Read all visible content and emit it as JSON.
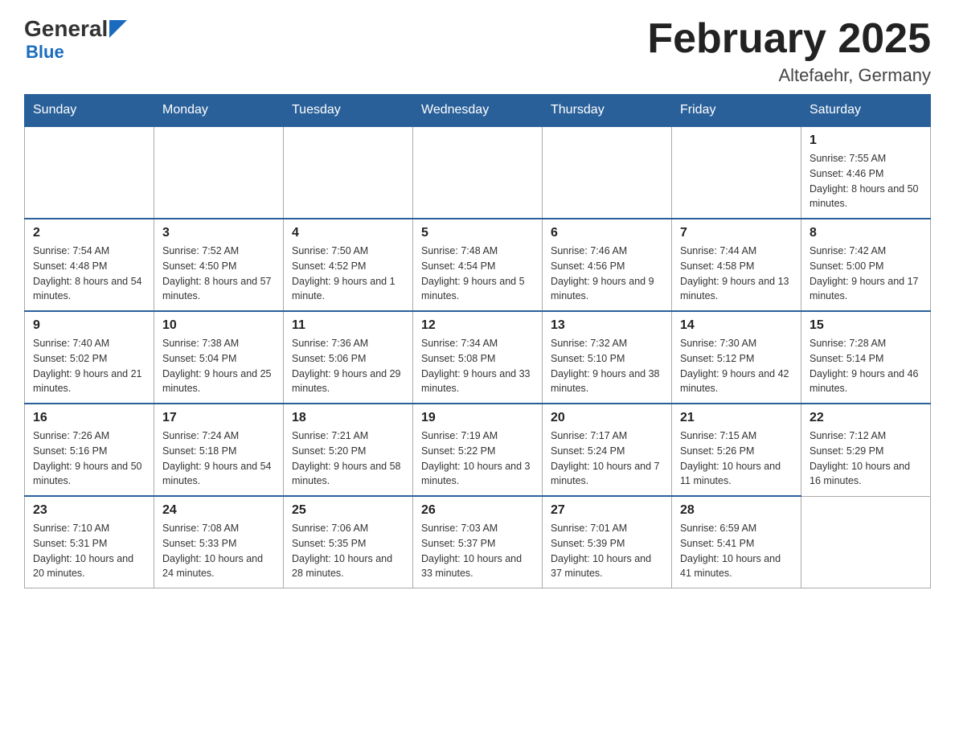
{
  "logo": {
    "general": "General",
    "blue": "Blue",
    "line2": "Blue"
  },
  "title": "February 2025",
  "location": "Altefaehr, Germany",
  "days_of_week": [
    "Sunday",
    "Monday",
    "Tuesday",
    "Wednesday",
    "Thursday",
    "Friday",
    "Saturday"
  ],
  "weeks": [
    [
      {
        "day": "",
        "sunrise": "",
        "sunset": "",
        "daylight": ""
      },
      {
        "day": "",
        "sunrise": "",
        "sunset": "",
        "daylight": ""
      },
      {
        "day": "",
        "sunrise": "",
        "sunset": "",
        "daylight": ""
      },
      {
        "day": "",
        "sunrise": "",
        "sunset": "",
        "daylight": ""
      },
      {
        "day": "",
        "sunrise": "",
        "sunset": "",
        "daylight": ""
      },
      {
        "day": "",
        "sunrise": "",
        "sunset": "",
        "daylight": ""
      },
      {
        "day": "1",
        "sunrise": "Sunrise: 7:55 AM",
        "sunset": "Sunset: 4:46 PM",
        "daylight": "Daylight: 8 hours and 50 minutes."
      }
    ],
    [
      {
        "day": "2",
        "sunrise": "Sunrise: 7:54 AM",
        "sunset": "Sunset: 4:48 PM",
        "daylight": "Daylight: 8 hours and 54 minutes."
      },
      {
        "day": "3",
        "sunrise": "Sunrise: 7:52 AM",
        "sunset": "Sunset: 4:50 PM",
        "daylight": "Daylight: 8 hours and 57 minutes."
      },
      {
        "day": "4",
        "sunrise": "Sunrise: 7:50 AM",
        "sunset": "Sunset: 4:52 PM",
        "daylight": "Daylight: 9 hours and 1 minute."
      },
      {
        "day": "5",
        "sunrise": "Sunrise: 7:48 AM",
        "sunset": "Sunset: 4:54 PM",
        "daylight": "Daylight: 9 hours and 5 minutes."
      },
      {
        "day": "6",
        "sunrise": "Sunrise: 7:46 AM",
        "sunset": "Sunset: 4:56 PM",
        "daylight": "Daylight: 9 hours and 9 minutes."
      },
      {
        "day": "7",
        "sunrise": "Sunrise: 7:44 AM",
        "sunset": "Sunset: 4:58 PM",
        "daylight": "Daylight: 9 hours and 13 minutes."
      },
      {
        "day": "8",
        "sunrise": "Sunrise: 7:42 AM",
        "sunset": "Sunset: 5:00 PM",
        "daylight": "Daylight: 9 hours and 17 minutes."
      }
    ],
    [
      {
        "day": "9",
        "sunrise": "Sunrise: 7:40 AM",
        "sunset": "Sunset: 5:02 PM",
        "daylight": "Daylight: 9 hours and 21 minutes."
      },
      {
        "day": "10",
        "sunrise": "Sunrise: 7:38 AM",
        "sunset": "Sunset: 5:04 PM",
        "daylight": "Daylight: 9 hours and 25 minutes."
      },
      {
        "day": "11",
        "sunrise": "Sunrise: 7:36 AM",
        "sunset": "Sunset: 5:06 PM",
        "daylight": "Daylight: 9 hours and 29 minutes."
      },
      {
        "day": "12",
        "sunrise": "Sunrise: 7:34 AM",
        "sunset": "Sunset: 5:08 PM",
        "daylight": "Daylight: 9 hours and 33 minutes."
      },
      {
        "day": "13",
        "sunrise": "Sunrise: 7:32 AM",
        "sunset": "Sunset: 5:10 PM",
        "daylight": "Daylight: 9 hours and 38 minutes."
      },
      {
        "day": "14",
        "sunrise": "Sunrise: 7:30 AM",
        "sunset": "Sunset: 5:12 PM",
        "daylight": "Daylight: 9 hours and 42 minutes."
      },
      {
        "day": "15",
        "sunrise": "Sunrise: 7:28 AM",
        "sunset": "Sunset: 5:14 PM",
        "daylight": "Daylight: 9 hours and 46 minutes."
      }
    ],
    [
      {
        "day": "16",
        "sunrise": "Sunrise: 7:26 AM",
        "sunset": "Sunset: 5:16 PM",
        "daylight": "Daylight: 9 hours and 50 minutes."
      },
      {
        "day": "17",
        "sunrise": "Sunrise: 7:24 AM",
        "sunset": "Sunset: 5:18 PM",
        "daylight": "Daylight: 9 hours and 54 minutes."
      },
      {
        "day": "18",
        "sunrise": "Sunrise: 7:21 AM",
        "sunset": "Sunset: 5:20 PM",
        "daylight": "Daylight: 9 hours and 58 minutes."
      },
      {
        "day": "19",
        "sunrise": "Sunrise: 7:19 AM",
        "sunset": "Sunset: 5:22 PM",
        "daylight": "Daylight: 10 hours and 3 minutes."
      },
      {
        "day": "20",
        "sunrise": "Sunrise: 7:17 AM",
        "sunset": "Sunset: 5:24 PM",
        "daylight": "Daylight: 10 hours and 7 minutes."
      },
      {
        "day": "21",
        "sunrise": "Sunrise: 7:15 AM",
        "sunset": "Sunset: 5:26 PM",
        "daylight": "Daylight: 10 hours and 11 minutes."
      },
      {
        "day": "22",
        "sunrise": "Sunrise: 7:12 AM",
        "sunset": "Sunset: 5:29 PM",
        "daylight": "Daylight: 10 hours and 16 minutes."
      }
    ],
    [
      {
        "day": "23",
        "sunrise": "Sunrise: 7:10 AM",
        "sunset": "Sunset: 5:31 PM",
        "daylight": "Daylight: 10 hours and 20 minutes."
      },
      {
        "day": "24",
        "sunrise": "Sunrise: 7:08 AM",
        "sunset": "Sunset: 5:33 PM",
        "daylight": "Daylight: 10 hours and 24 minutes."
      },
      {
        "day": "25",
        "sunrise": "Sunrise: 7:06 AM",
        "sunset": "Sunset: 5:35 PM",
        "daylight": "Daylight: 10 hours and 28 minutes."
      },
      {
        "day": "26",
        "sunrise": "Sunrise: 7:03 AM",
        "sunset": "Sunset: 5:37 PM",
        "daylight": "Daylight: 10 hours and 33 minutes."
      },
      {
        "day": "27",
        "sunrise": "Sunrise: 7:01 AM",
        "sunset": "Sunset: 5:39 PM",
        "daylight": "Daylight: 10 hours and 37 minutes."
      },
      {
        "day": "28",
        "sunrise": "Sunrise: 6:59 AM",
        "sunset": "Sunset: 5:41 PM",
        "daylight": "Daylight: 10 hours and 41 minutes."
      },
      {
        "day": "",
        "sunrise": "",
        "sunset": "",
        "daylight": ""
      }
    ]
  ]
}
